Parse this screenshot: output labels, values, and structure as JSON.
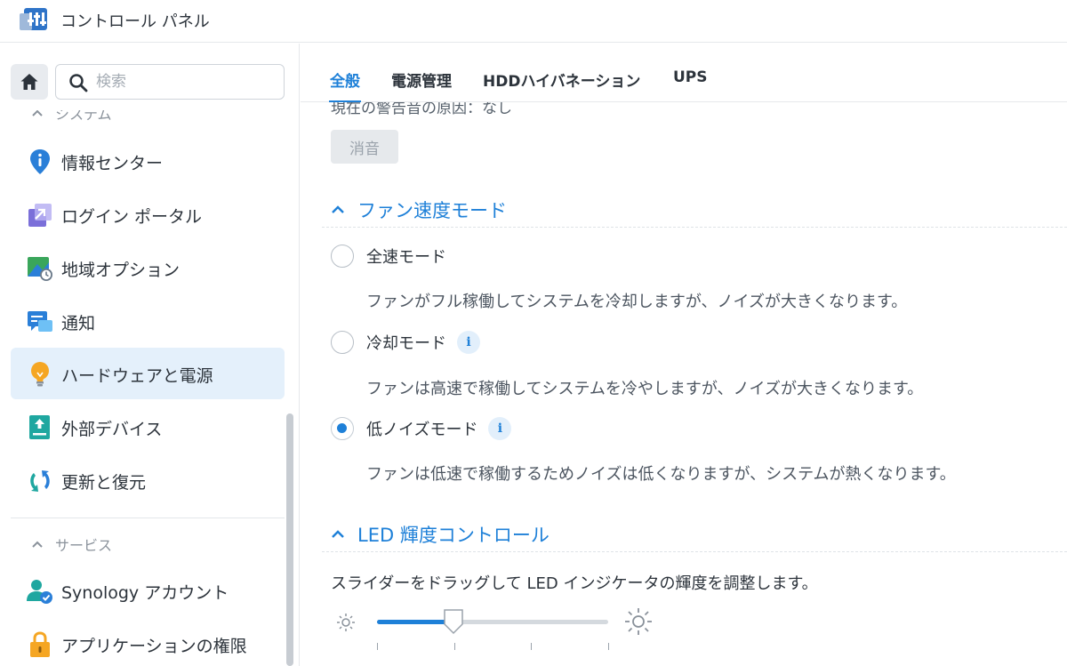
{
  "app": {
    "title": "コントロール パネル"
  },
  "sidebar": {
    "search_placeholder": "検索",
    "section_system": "システム",
    "section_services": "サービス",
    "items": [
      {
        "label": "情報センター",
        "icon": "info-pin-icon"
      },
      {
        "label": "ログイン ポータル",
        "icon": "login-portal-icon"
      },
      {
        "label": "地域オプション",
        "icon": "regional-options-icon"
      },
      {
        "label": "通知",
        "icon": "notification-icon"
      },
      {
        "label": "ハードウェアと電源",
        "icon": "lightbulb-icon",
        "active": true
      },
      {
        "label": "外部デバイス",
        "icon": "external-device-icon"
      },
      {
        "label": "更新と復元",
        "icon": "update-restore-icon"
      }
    ],
    "service_items": [
      {
        "label": "Synology アカウント",
        "icon": "synology-account-icon"
      },
      {
        "label": "アプリケーションの権限",
        "icon": "lock-icon"
      }
    ]
  },
  "tabs": [
    {
      "label": "全般",
      "active": true
    },
    {
      "label": "電源管理"
    },
    {
      "label": "HDDハイバネーション"
    },
    {
      "label": "UPS"
    }
  ],
  "main": {
    "partial_text": "現在の警告音の原因：なし",
    "mute_button": "消音",
    "fan": {
      "heading": "ファン速度モード",
      "options": [
        {
          "label": "全速モード",
          "desc": "ファンがフル稼働してシステムを冷却しますが、ノイズが大きくなります。",
          "checked": false,
          "info": false
        },
        {
          "label": "冷却モード",
          "desc": "ファンは高速で稼働してシステムを冷やしますが、ノイズが大きくなります。",
          "checked": false,
          "info": true
        },
        {
          "label": "低ノイズモード",
          "desc": "ファンは低速で稼働するためノイズは低くなりますが、システムが熱くなります。",
          "checked": true,
          "info": true
        }
      ]
    },
    "led": {
      "heading": "LED 輝度コントロール",
      "desc": "スライダーをドラッグして LED インジケータの輝度を調整します。",
      "slider_level": 0.33,
      "slider_ticks": 4
    }
  },
  "colors": {
    "accent": "#1e80d8",
    "active_bg": "#e4f0fb"
  }
}
